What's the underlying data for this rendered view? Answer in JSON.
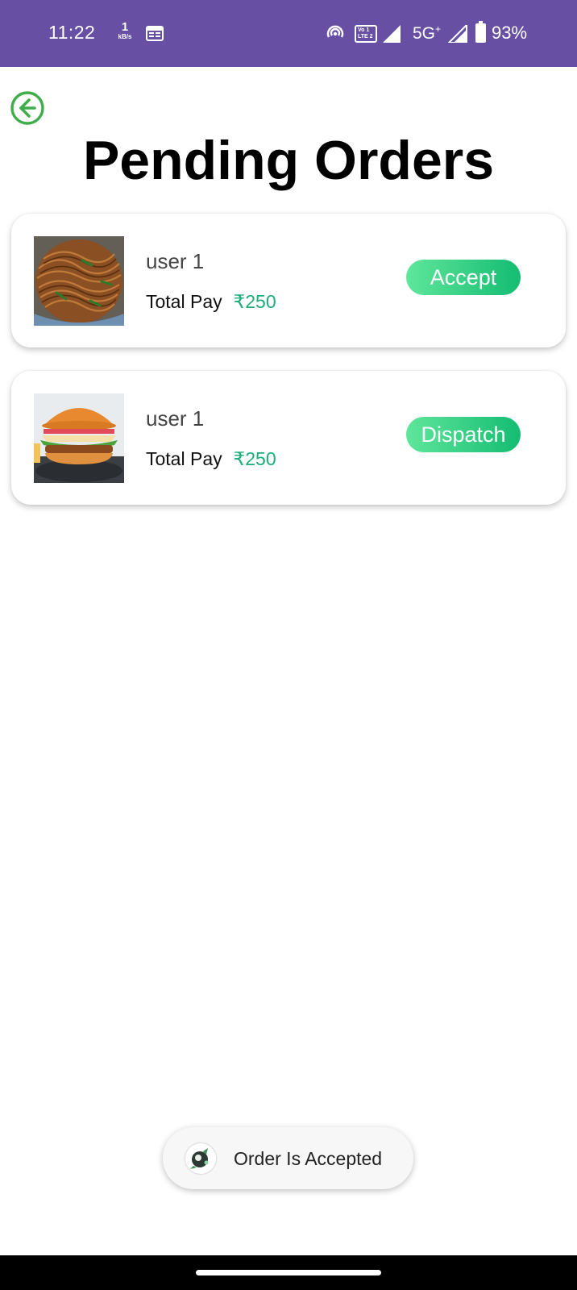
{
  "status_bar": {
    "time": "11:22",
    "speed_value": "1",
    "speed_unit": "kB/s",
    "volte_line1": "Vo 1",
    "volte_line2": "LTE 2",
    "network": "5G",
    "network_sup": "+",
    "battery_percent": "93%",
    "background_color": "#6750A4"
  },
  "header": {
    "back_icon": "arrow-left-circle-icon",
    "title": "Pending Orders"
  },
  "orders": [
    {
      "image_icon": "noodles-image",
      "user": "user 1",
      "total_label": "Total Pay",
      "amount": "₹250",
      "action_label": "Accept"
    },
    {
      "image_icon": "burger-image",
      "user": "user 1",
      "total_label": "Total Pay",
      "amount": "₹250",
      "action_label": "Dispatch"
    }
  ],
  "toast": {
    "icon": "app-logo-icon",
    "message": "Order Is Accepted"
  },
  "colors": {
    "accent_green": "#1AAE78",
    "button_gradient_start": "#5FE69B",
    "button_gradient_end": "#14BC72",
    "back_icon_color": "#3FAE4A"
  }
}
